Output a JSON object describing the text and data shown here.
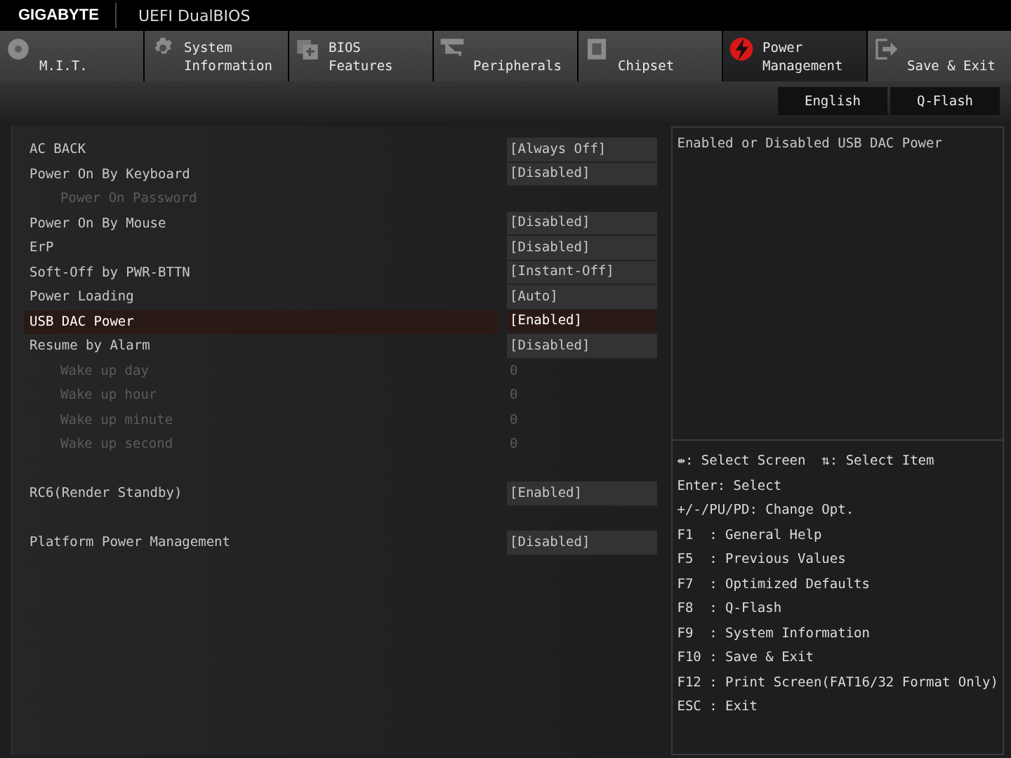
{
  "header": {
    "brand": "GIGABYTE",
    "title": "UEFI DualBIOS"
  },
  "tabs": [
    {
      "label": "M.I.T.",
      "selected": false
    },
    {
      "label": "System\nInformation",
      "selected": false
    },
    {
      "label": "BIOS\nFeatures",
      "selected": false
    },
    {
      "label": "Peripherals",
      "selected": false
    },
    {
      "label": "Chipset",
      "selected": false
    },
    {
      "label": "Power\nManagement",
      "selected": true
    },
    {
      "label": "Save & Exit",
      "selected": false
    }
  ],
  "toolbar_buttons": [
    "English",
    "Q-Flash"
  ],
  "setting_groups": [
    [
      {
        "label": "AC BACK",
        "value": "[Always Off]",
        "selected": false,
        "disabled": false
      },
      {
        "label": "Power On By Keyboard",
        "value": "[Disabled]",
        "selected": false,
        "disabled": false,
        "children": [
          {
            "label": "Power On Password",
            "selected": false,
            "disabled": true
          }
        ]
      },
      {
        "label": "Power On By Mouse",
        "value": "[Disabled]",
        "selected": false,
        "disabled": false
      },
      {
        "label": "ErP",
        "value": "[Disabled]",
        "selected": false,
        "disabled": false
      },
      {
        "label": "Soft-Off by PWR-BTTN",
        "value": "[Instant-Off]",
        "selected": false,
        "disabled": false
      },
      {
        "label": "Power Loading",
        "value": "[Auto]",
        "selected": false,
        "disabled": false
      },
      {
        "label": "USB DAC Power",
        "value": "[Enabled]",
        "selected": true,
        "disabled": false
      },
      {
        "label": "Resume by Alarm",
        "value": "[Disabled]",
        "selected": false,
        "disabled": false,
        "children": [
          {
            "label": "Wake up day",
            "value": "0",
            "selected": false,
            "disabled": true
          },
          {
            "label": "Wake up hour",
            "value": "0",
            "selected": false,
            "disabled": true
          },
          {
            "label": "Wake up minute",
            "value": "0",
            "selected": false,
            "disabled": true
          },
          {
            "label": "Wake up second",
            "value": "0",
            "selected": false,
            "disabled": true
          }
        ]
      }
    ],
    [
      {
        "label": "RC6(Render Standby)",
        "value": "[Enabled]",
        "selected": false,
        "disabled": false
      }
    ],
    [
      {
        "label": "Platform Power Management",
        "value": "[Disabled]",
        "selected": false,
        "disabled": false
      }
    ]
  ],
  "help_text": "Enabled or Disabled USB DAC Power",
  "key_help": [
    "⇹: Select Screen  ⇅: Select Item",
    "Enter: Select",
    "+/-/PU/PD: Change Opt.",
    "F1  : General Help",
    "F5  : Previous Values",
    "F7  : Optimized Defaults",
    "F8  : Q-Flash",
    "F9  : System Information",
    "F10 : Save & Exit",
    "F12 : Print Screen(FAT16/32 Format Only)",
    "ESC : Exit"
  ]
}
